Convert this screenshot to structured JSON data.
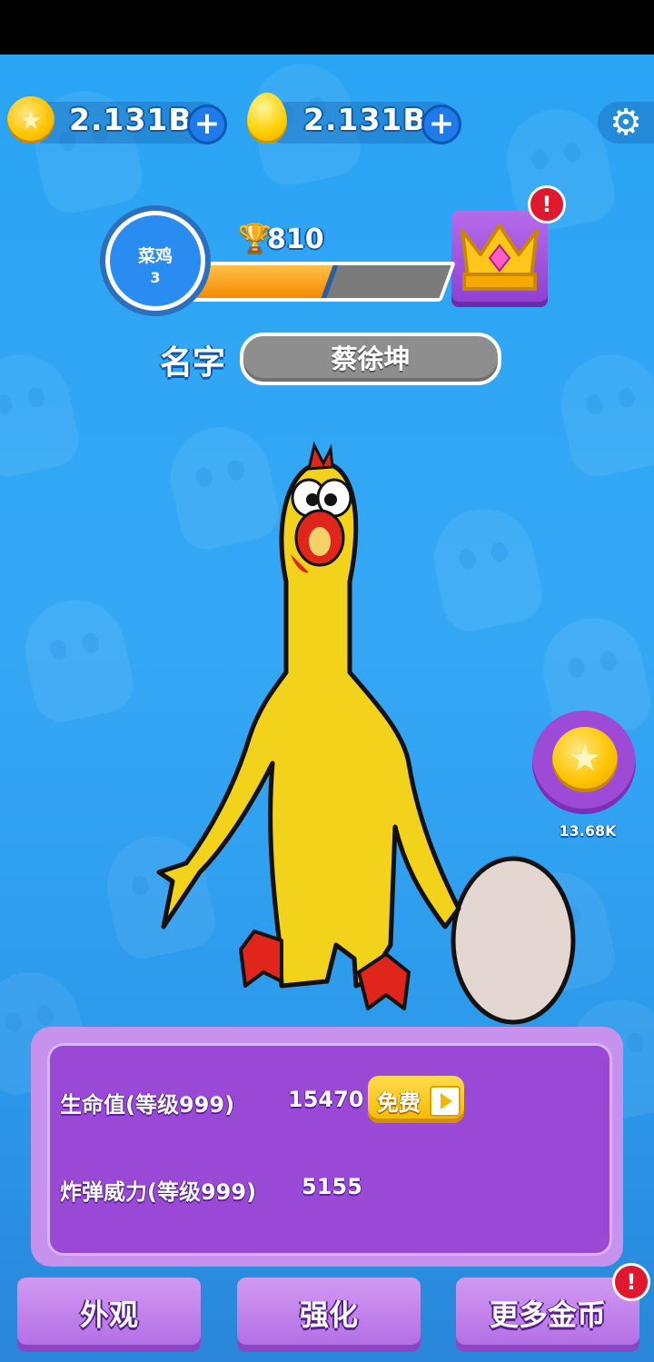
{
  "currency": {
    "coins": "2.131B",
    "eggs": "2.131B"
  },
  "player": {
    "rank": "菜鸡",
    "level": "3",
    "trophies": "810",
    "xp_progress": 0.56
  },
  "name": {
    "label": "名字",
    "value": "蔡徐坤"
  },
  "coin_reward": {
    "amount": "13.68K"
  },
  "stats": [
    {
      "label": "生命值(等级999)",
      "value": "15470"
    },
    {
      "label": "炸弹威力(等级999)",
      "value": "5155"
    }
  ],
  "free_button": {
    "label": "免费"
  },
  "alert_mark": "!",
  "bottom_nav": {
    "appearance": "外观",
    "upgrade": "强化",
    "more_coins": "更多金币"
  },
  "icons": {
    "coin": "star-coin-icon",
    "egg": "golden-egg-icon",
    "settings": "gear-icon",
    "trophy": "trophy-icon",
    "crown": "crown-icon",
    "video": "play-icon"
  },
  "colors": {
    "sky": "#35a8f5",
    "panel": "#9a49d6",
    "button": "#c08af0",
    "accent_gold": "#ffc400",
    "alert": "#e0182e"
  }
}
